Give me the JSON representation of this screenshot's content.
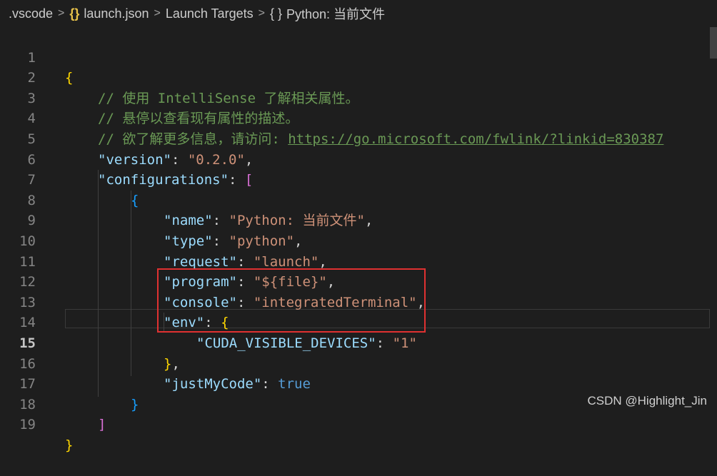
{
  "breadcrumb": {
    "folder": ".vscode",
    "file_icon": "json-braces-icon",
    "file": "launch.json",
    "section": "Launch Targets",
    "item_icon": "object-braces-icon",
    "item": "Python: 当前文件",
    "separator": ">",
    "brace_glyph": "{}",
    "brace_glyph_spaced": "{ }"
  },
  "editor": {
    "active_line": 15,
    "lines": [
      {
        "n": "1"
      },
      {
        "n": "2"
      },
      {
        "n": "3"
      },
      {
        "n": "4"
      },
      {
        "n": "5"
      },
      {
        "n": "6"
      },
      {
        "n": "7"
      },
      {
        "n": "8"
      },
      {
        "n": "9"
      },
      {
        "n": "10"
      },
      {
        "n": "11"
      },
      {
        "n": "12"
      },
      {
        "n": "13"
      },
      {
        "n": "14"
      },
      {
        "n": "15"
      },
      {
        "n": "16"
      },
      {
        "n": "17"
      },
      {
        "n": "18"
      },
      {
        "n": "19"
      }
    ],
    "tokens": {
      "open_brace": "{",
      "close_brace": "}",
      "open_bracket": "[",
      "close_bracket": "]",
      "comment1": "// 使用 IntelliSense 了解相关属性。",
      "comment2": "// 悬停以查看现有属性的描述。",
      "comment3_prefix": "// 欲了解更多信息，请访问: ",
      "comment3_link": "https://go.microsoft.com/fwlink/?linkid=830387",
      "k_version": "\"version\"",
      "v_version": "\"0.2.0\"",
      "k_configurations": "\"configurations\"",
      "k_name": "\"name\"",
      "v_name": "\"Python: 当前文件\"",
      "k_type": "\"type\"",
      "v_type": "\"python\"",
      "k_request": "\"request\"",
      "v_request": "\"launch\"",
      "k_program": "\"program\"",
      "v_program": "\"${file}\"",
      "k_console": "\"console\"",
      "v_console": "\"integratedTerminal\"",
      "k_env": "\"env\"",
      "k_cuda": "\"CUDA_VISIBLE_DEVICES\"",
      "v_cuda": "\"1\"",
      "k_justMyCode": "\"justMyCode\"",
      "v_justMyCode": "true",
      "colon": ": ",
      "comma": ","
    }
  },
  "watermark": "CSDN @Highlight_Jin",
  "colors": {
    "background": "#1e1e1e",
    "comment": "#6a9955",
    "key": "#9cdcfe",
    "string": "#ce9178",
    "keyword": "#569cd6",
    "brace_level1": "#ffd700",
    "brace_level2": "#da70d6",
    "brace_level3": "#179fff",
    "annotation_box": "#e03131"
  }
}
